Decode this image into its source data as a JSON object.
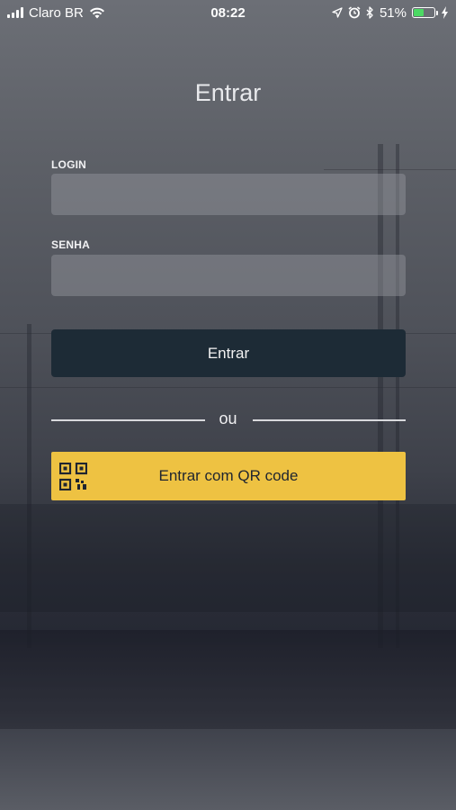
{
  "status_bar": {
    "carrier": "Claro BR",
    "time": "08:22",
    "battery_percent": "51%",
    "battery_level": 0.51,
    "battery_color": "#4cd964"
  },
  "screen": {
    "title": "Entrar"
  },
  "form": {
    "login_label": "LOGIN",
    "login_value": "",
    "password_label": "SENHA",
    "password_value": "",
    "submit_label": "Entrar",
    "separator_text": "ou",
    "qr_button_label": "Entrar com QR code",
    "qr_button_color": "#eec242",
    "submit_button_color": "#1d2b36"
  },
  "icons": {
    "signal": "signal-bars-icon",
    "wifi": "wifi-icon",
    "location": "location-arrow-icon",
    "alarm": "alarm-clock-icon",
    "bluetooth": "bluetooth-icon",
    "battery": "battery-icon",
    "charging": "charging-bolt-icon",
    "qr": "qr-code-icon"
  }
}
